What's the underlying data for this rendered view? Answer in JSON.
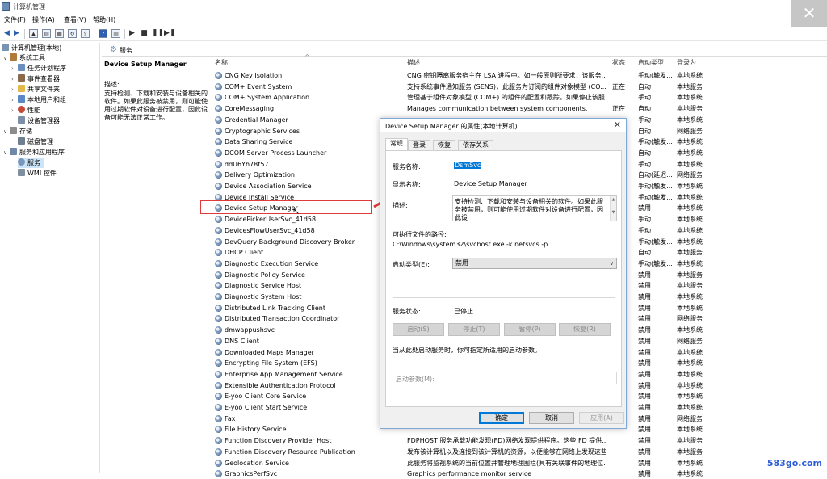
{
  "window": {
    "title": "计算机管理",
    "close_glyph": "✕"
  },
  "menu": [
    "文件(F)",
    "操作(A)",
    "查看(V)",
    "帮助(H)"
  ],
  "tree": {
    "root": "计算机管理(本地)",
    "system_tools": "系统工具",
    "task_scheduler": "任务计划程序",
    "event_viewer": "事件查看器",
    "shared_folders": "共享文件夹",
    "local_users": "本地用户和组",
    "performance": "性能",
    "device_manager": "设备管理器",
    "storage": "存储",
    "disk_mgmt": "磁盘管理",
    "services_apps": "服务和应用程序",
    "services": "服务",
    "wmi": "WMI 控件"
  },
  "main_header": "服务",
  "desc_pane": {
    "title": "Device Setup Manager",
    "label": "描述:",
    "body": "支持检测、下载和安装与设备相关的软件。如果此服务被禁用，则可能使用过期软件对设备进行配置，因此设备可能无法正常工作。"
  },
  "columns": {
    "name": "名称",
    "desc": "描述",
    "status": "状态",
    "startup": "启动类型",
    "logon": "登录为"
  },
  "rows": [
    {
      "name": "CNG Key Isolation",
      "desc": "CNG 密钥隔离服务宿主在 LSA 进程中。如一般原则所要求，该服务...",
      "status": "",
      "startup": "手动(触发...",
      "logon": "本地系统"
    },
    {
      "name": "COM+ Event System",
      "desc": "支持系统事件通知服务 (SENS)，此服务为订阅的组件对象模型 (CO...",
      "status": "正在",
      "startup": "自动",
      "logon": "本地服务"
    },
    {
      "name": "COM+ System Application",
      "desc": "管理基于组件对象模型 (COM+) 的组件的配置和跟踪。如果停止该服...",
      "status": "",
      "startup": "手动",
      "logon": "本地系统"
    },
    {
      "name": "CoreMessaging",
      "desc": "Manages communication between system components.",
      "status": "正在",
      "startup": "自动",
      "logon": "本地服务"
    },
    {
      "name": "Credential Manager",
      "desc": "",
      "status": "",
      "startup": "手动",
      "logon": "本地系统"
    },
    {
      "name": "Cryptographic Services",
      "desc": "",
      "status": "",
      "startup": "自动",
      "logon": "网络服务"
    },
    {
      "name": "Data Sharing Service",
      "desc": "",
      "status": "",
      "startup": "手动(触发...",
      "logon": "本地系统"
    },
    {
      "name": "DCOM Server Process Launcher",
      "desc": "",
      "status": "",
      "startup": "自动",
      "logon": "本地系统"
    },
    {
      "name": "ddU6Yh78t57",
      "desc": "",
      "status": "",
      "startup": "手动",
      "logon": "本地系统"
    },
    {
      "name": "Delivery Optimization",
      "desc": "",
      "status": "",
      "startup": "自动(延迟...",
      "logon": "网络服务"
    },
    {
      "name": "Device Association Service",
      "desc": "",
      "status": "",
      "startup": "手动(触发...",
      "logon": "本地系统"
    },
    {
      "name": "Device Install Service",
      "desc": "",
      "status": "",
      "startup": "手动(触发...",
      "logon": "本地系统"
    },
    {
      "name": "Device Setup Manager",
      "desc": "",
      "status": "",
      "startup": "禁用",
      "logon": "本地系统"
    },
    {
      "name": "DevicePickerUserSvc_41d58",
      "desc": "",
      "status": "",
      "startup": "手动",
      "logon": "本地系统"
    },
    {
      "name": "DevicesFlowUserSvc_41d58",
      "desc": "",
      "status": "",
      "startup": "手动",
      "logon": "本地系统"
    },
    {
      "name": "DevQuery Background Discovery Broker",
      "desc": "",
      "status": "",
      "startup": "手动(触发...",
      "logon": "本地系统"
    },
    {
      "name": "DHCP Client",
      "desc": "",
      "status": "",
      "startup": "自动",
      "logon": "本地服务"
    },
    {
      "name": "Diagnostic Execution Service",
      "desc": "",
      "status": "",
      "startup": "手动(触发...",
      "logon": "本地系统"
    },
    {
      "name": "Diagnostic Policy Service",
      "desc": "",
      "status": "",
      "startup": "禁用",
      "logon": "本地服务"
    },
    {
      "name": "Diagnostic Service Host",
      "desc": "",
      "status": "",
      "startup": "禁用",
      "logon": "本地服务"
    },
    {
      "name": "Diagnostic System Host",
      "desc": "",
      "status": "",
      "startup": "禁用",
      "logon": "本地系统"
    },
    {
      "name": "Distributed Link Tracking Client",
      "desc": "",
      "status": "",
      "startup": "禁用",
      "logon": "本地系统"
    },
    {
      "name": "Distributed Transaction Coordinator",
      "desc": "",
      "status": "",
      "startup": "禁用",
      "logon": "网络服务"
    },
    {
      "name": "dmwappushsvc",
      "desc": "",
      "status": "",
      "startup": "禁用",
      "logon": "本地系统"
    },
    {
      "name": "DNS Client",
      "desc": "",
      "status": "",
      "startup": "禁用",
      "logon": "网络服务"
    },
    {
      "name": "Downloaded Maps Manager",
      "desc": "",
      "status": "",
      "startup": "禁用",
      "logon": "本地系统"
    },
    {
      "name": "Encrypting File System (EFS)",
      "desc": "",
      "status": "",
      "startup": "禁用",
      "logon": "本地系统"
    },
    {
      "name": "Enterprise App Management Service",
      "desc": "",
      "status": "",
      "startup": "禁用",
      "logon": "本地系统"
    },
    {
      "name": "Extensible Authentication Protocol",
      "desc": "",
      "status": "",
      "startup": "禁用",
      "logon": "本地系统"
    },
    {
      "name": "E-yoo Client Core Service",
      "desc": "",
      "status": "",
      "startup": "禁用",
      "logon": "本地系统"
    },
    {
      "name": "E-yoo Client Start Service",
      "desc": "",
      "status": "",
      "startup": "禁用",
      "logon": "本地系统"
    },
    {
      "name": "Fax",
      "desc": "",
      "status": "",
      "startup": "禁用",
      "logon": "网络服务"
    },
    {
      "name": "File History Service",
      "desc": "",
      "status": "",
      "startup": "禁用",
      "logon": "本地系统"
    },
    {
      "name": "Function Discovery Provider Host",
      "desc": "FDPHOST 服务承载功能发现(FD)网络发现提供程序。这些 FD 提供...",
      "status": "",
      "startup": "禁用",
      "logon": "本地服务"
    },
    {
      "name": "Function Discovery Resource Publication",
      "desc": "发布该计算机以及连接到该计算机的资源，以便能够在网络上发现这些...",
      "status": "",
      "startup": "禁用",
      "logon": "本地服务"
    },
    {
      "name": "Geolocation Service",
      "desc": "此服务将监视系统的当前位置并管理地理围栏(具有关联事件的地理位...",
      "status": "",
      "startup": "禁用",
      "logon": "本地系统"
    },
    {
      "name": "GraphicsPerfSvc",
      "desc": "Graphics performance monitor service",
      "status": "",
      "startup": "禁用",
      "logon": "本地系统"
    }
  ],
  "dialog": {
    "title": "Device Setup Manager 的属性(本地计算机)",
    "close_glyph": "✕",
    "tabs": [
      "常规",
      "登录",
      "恢复",
      "依存关系"
    ],
    "service_name_label": "服务名称:",
    "service_name_value": "DsmSvc",
    "display_name_label": "显示名称:",
    "display_name_value": "Device Setup Manager",
    "description_label": "描述:",
    "description_value": "支持检测、下载和安装与设备相关的软件。如果此服务被禁用，则可能使用过期软件对设备进行配置，因此设",
    "path_label": "可执行文件的路径:",
    "path_value": "C:\\Windows\\system32\\svchost.exe -k netsvcs -p",
    "startup_label": "启动类型(E):",
    "startup_value": "禁用",
    "status_label": "服务状态:",
    "status_value": "已停止",
    "buttons": {
      "start": "启动(S)",
      "stop": "停止(T)",
      "pause": "暂停(P)",
      "resume": "恢复(R)"
    },
    "hint": "当从此处启动服务时，你可指定所适用的启动参数。",
    "params_label": "启动参数(M):",
    "ok": "确定",
    "cancel": "取消",
    "apply": "应用(A)"
  },
  "watermark": "583go.com"
}
